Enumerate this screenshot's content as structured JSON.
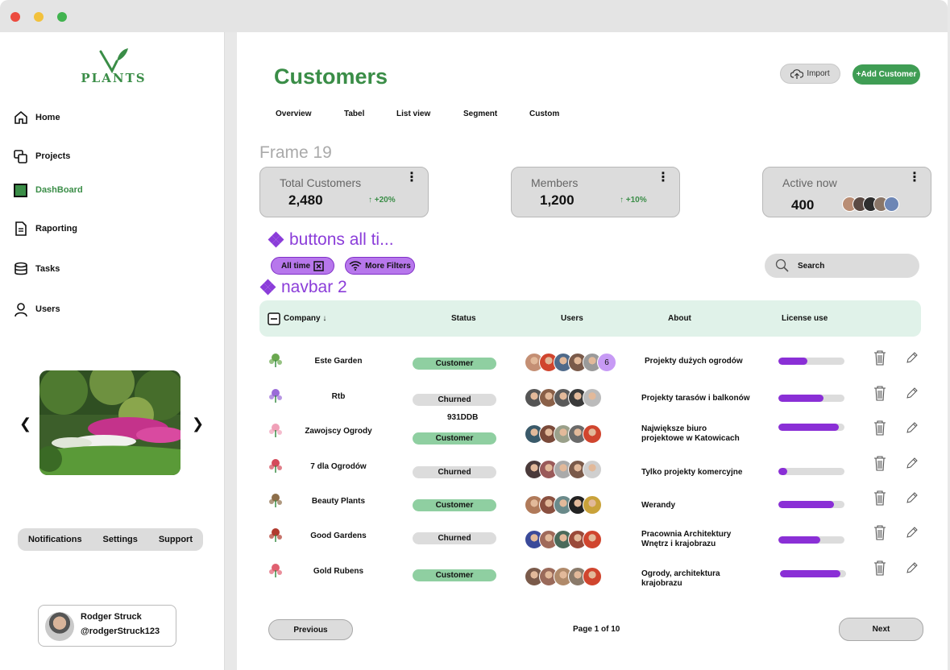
{
  "brand": {
    "name": "PLANTS"
  },
  "nav": [
    {
      "label": "Home",
      "icon": "home-icon"
    },
    {
      "label": "Projects",
      "icon": "projects-icon"
    },
    {
      "label": "DashBoard",
      "icon": "dashboard-icon",
      "active": true
    },
    {
      "label": "Raporting",
      "icon": "report-icon"
    },
    {
      "label": "Tasks",
      "icon": "tasks-icon"
    },
    {
      "label": "Users",
      "icon": "user-icon"
    }
  ],
  "bottom_menu": [
    "Notifications",
    "Settings",
    "Support"
  ],
  "user": {
    "name": "Rodger Struck",
    "handle": "@rodgerStruck123"
  },
  "header": {
    "title": "Customers",
    "import_label": "Import",
    "add_label": "+Add Customer"
  },
  "tabs": [
    "Overview",
    "Tabel",
    "List view",
    "Segment",
    "Custom"
  ],
  "frame_label": "Frame 19",
  "stats": [
    {
      "title": "Total Customers",
      "value": "2,480",
      "change": "+20%"
    },
    {
      "title": "Members",
      "value": "1,200",
      "change": "+10%"
    },
    {
      "title": "Active now",
      "value": "400"
    }
  ],
  "component_labels": {
    "buttons": "buttons all ti...",
    "navbar": "navbar 2"
  },
  "filters": {
    "all_time": "All time",
    "more": "More Filters"
  },
  "search": {
    "placeholder": "Search"
  },
  "table": {
    "headers": {
      "company": "Company",
      "status": "Status",
      "users": "Users",
      "about": "About",
      "license": "License use"
    },
    "rows": [
      {
        "company": "Este Garden",
        "status": "Customer",
        "about": "Projekty dużych ogrodów",
        "license": 0.44,
        "extra_users": "6"
      },
      {
        "company": "Rtb",
        "status": "Churned",
        "about": "Projekty tarasów i balkonów",
        "license": 0.68
      },
      {
        "company": "Zawojscy Ogrody",
        "status": "Customer",
        "about": "Największe biuro projektowe w Katowicach",
        "license": 0.92,
        "note": "931DDB"
      },
      {
        "company": "7 dla Ogrodów",
        "status": "Churned",
        "about": "Tylko projekty komercyjne",
        "license": 0.14
      },
      {
        "company": "Beauty Plants",
        "status": "Customer",
        "about": "Werandy",
        "license": 0.84
      },
      {
        "company": "Good Gardens",
        "status": "Churned",
        "about": "Pracownia Architektury Wnętrz i krajobrazu",
        "license": 0.64
      },
      {
        "company": "Gold Rubens",
        "status": "Customer",
        "about": "Ogrody, architektura krajobrazu",
        "license": 0.92
      }
    ]
  },
  "pagination": {
    "previous": "Previous",
    "info": "Page 1 of 10",
    "next": "Next"
  },
  "colors": {
    "brand_green": "#3a8d47",
    "accent_purple": "#8a2fd6",
    "customer_badge": "#8fcfa1"
  }
}
